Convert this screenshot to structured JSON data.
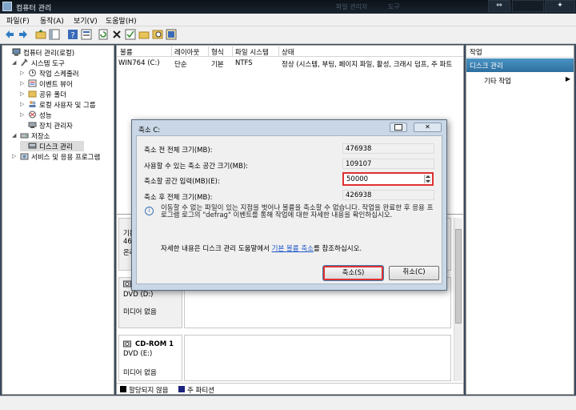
{
  "window": {
    "title": "컴퓨터 관리",
    "title_ghost_1": "파일 관리자",
    "title_ghost_2": "도구"
  },
  "menu": [
    "파일(F)",
    "동작(A)",
    "보기(V)",
    "도움말(H)"
  ],
  "tree": [
    {
      "label": "컴퓨터 관리(로컬)",
      "expander": "",
      "icon": "computer-icon",
      "indent": 0
    },
    {
      "label": "시스템 도구",
      "expander": "◢",
      "icon": "tools-icon",
      "indent": 1
    },
    {
      "label": "작업 스케줄러",
      "expander": "▷",
      "icon": "clock-icon",
      "indent": 2
    },
    {
      "label": "이벤트 뷰어",
      "expander": "▷",
      "icon": "event-viewer-icon",
      "indent": 2
    },
    {
      "label": "공유 폴더",
      "expander": "▷",
      "icon": "shared-folder-icon",
      "indent": 2
    },
    {
      "label": "로컬 사용자 및 그룹",
      "expander": "▷",
      "icon": "users-icon",
      "indent": 2
    },
    {
      "label": "성능",
      "expander": "▷",
      "icon": "performance-icon",
      "indent": 2
    },
    {
      "label": "장치 관리자",
      "expander": "",
      "icon": "device-manager-icon",
      "indent": 2
    },
    {
      "label": "저장소",
      "expander": "◢",
      "icon": "storage-icon",
      "indent": 1
    },
    {
      "label": "디스크 관리",
      "expander": "",
      "icon": "disk-icon",
      "indent": 2,
      "selected": true
    },
    {
      "label": "서비스 및 응용 프로그램",
      "expander": "▷",
      "icon": "services-icon",
      "indent": 1
    }
  ],
  "volume_table": {
    "headers": [
      "볼륨",
      "레이아웃",
      "형식",
      "파일 시스템",
      "상태"
    ],
    "row": [
      "WIN764 (C:)",
      "단순",
      "기본",
      "NTFS",
      "정상 (시스템, 부팅, 페이지 파일, 활성, 크래시 덤프, 주 파트"
    ]
  },
  "disks": [
    {
      "line1": "기본",
      "line2": "465",
      "line3": "온라"
    },
    {
      "name": "DVD (D:)",
      "status": "미디어 없음"
    },
    {
      "name": "CD-ROM 1",
      "type": "DVD (E:)",
      "status": "미디어 없음"
    }
  ],
  "legend": {
    "unallocated": "할당되지 않음",
    "primary": "주 파티션",
    "colors": {
      "unallocated": "#000000",
      "primary": "#1a237e"
    }
  },
  "actions": {
    "title": "작업",
    "section": "디스크 관리",
    "more": "기타 작업",
    "arrow": "▶"
  },
  "dialog": {
    "title": "축소 C:",
    "close": "✕",
    "total_before_label": "축소 전 전체 크기(MB):",
    "total_before_value": "476938",
    "available_label": "사용할 수 있는 축소 공간 크기(MB):",
    "available_value": "109107",
    "input_label": "축소할 공간 입력(MB)(E):",
    "input_value": "50000",
    "total_after_label": "축소 후 전체 크기(MB):",
    "total_after_value": "426938",
    "info": "이동할 수 없는 파일이 있는 지점을 벗어나 볼륨을 축소할 수 없습니다. 작업을 완료한 후 응용 프로그램 로그의 \"defrag\" 이벤트를 통해 작업에 대한 자세한 내용을 확인하십시오.",
    "help_prefix": "자세한 내용은 디스크 관리 도움말에서",
    "help_link": "기본 볼륨 축소",
    "help_suffix": "를 참조하십시오.",
    "ok": "축소(S)",
    "cancel": "취소(C)"
  }
}
